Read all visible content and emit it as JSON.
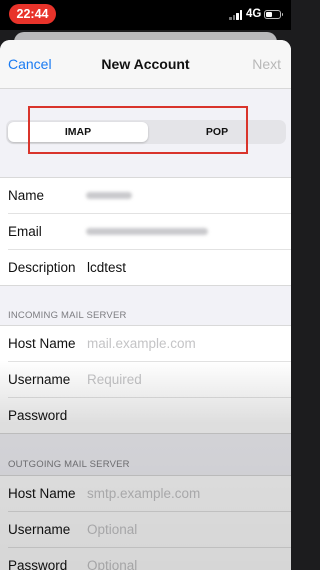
{
  "status_bar": {
    "time": "22:44",
    "network": "4G"
  },
  "nav": {
    "cancel_label": "Cancel",
    "title": "New Account",
    "next_label": "Next"
  },
  "segment": {
    "imap_label": "IMAP",
    "pop_label": "POP",
    "selected": "IMAP"
  },
  "account": {
    "name_label": "Name",
    "email_label": "Email",
    "description_label": "Description",
    "description_value": "lcdtest"
  },
  "incoming": {
    "header": "INCOMING MAIL SERVER",
    "host_label": "Host Name",
    "host_placeholder": "mail.example.com",
    "username_label": "Username",
    "username_placeholder": "Required",
    "password_label": "Password"
  },
  "outgoing": {
    "header": "OUTGOING MAIL SERVER",
    "host_label": "Host Name",
    "host_placeholder": "smtp.example.com",
    "username_label": "Username",
    "username_placeholder": "Optional",
    "password_label": "Password",
    "password_placeholder": "Optional"
  },
  "colors": {
    "accent": "#1a7bf2",
    "highlight": "#d9342b",
    "time_pill": "#e8332a"
  }
}
